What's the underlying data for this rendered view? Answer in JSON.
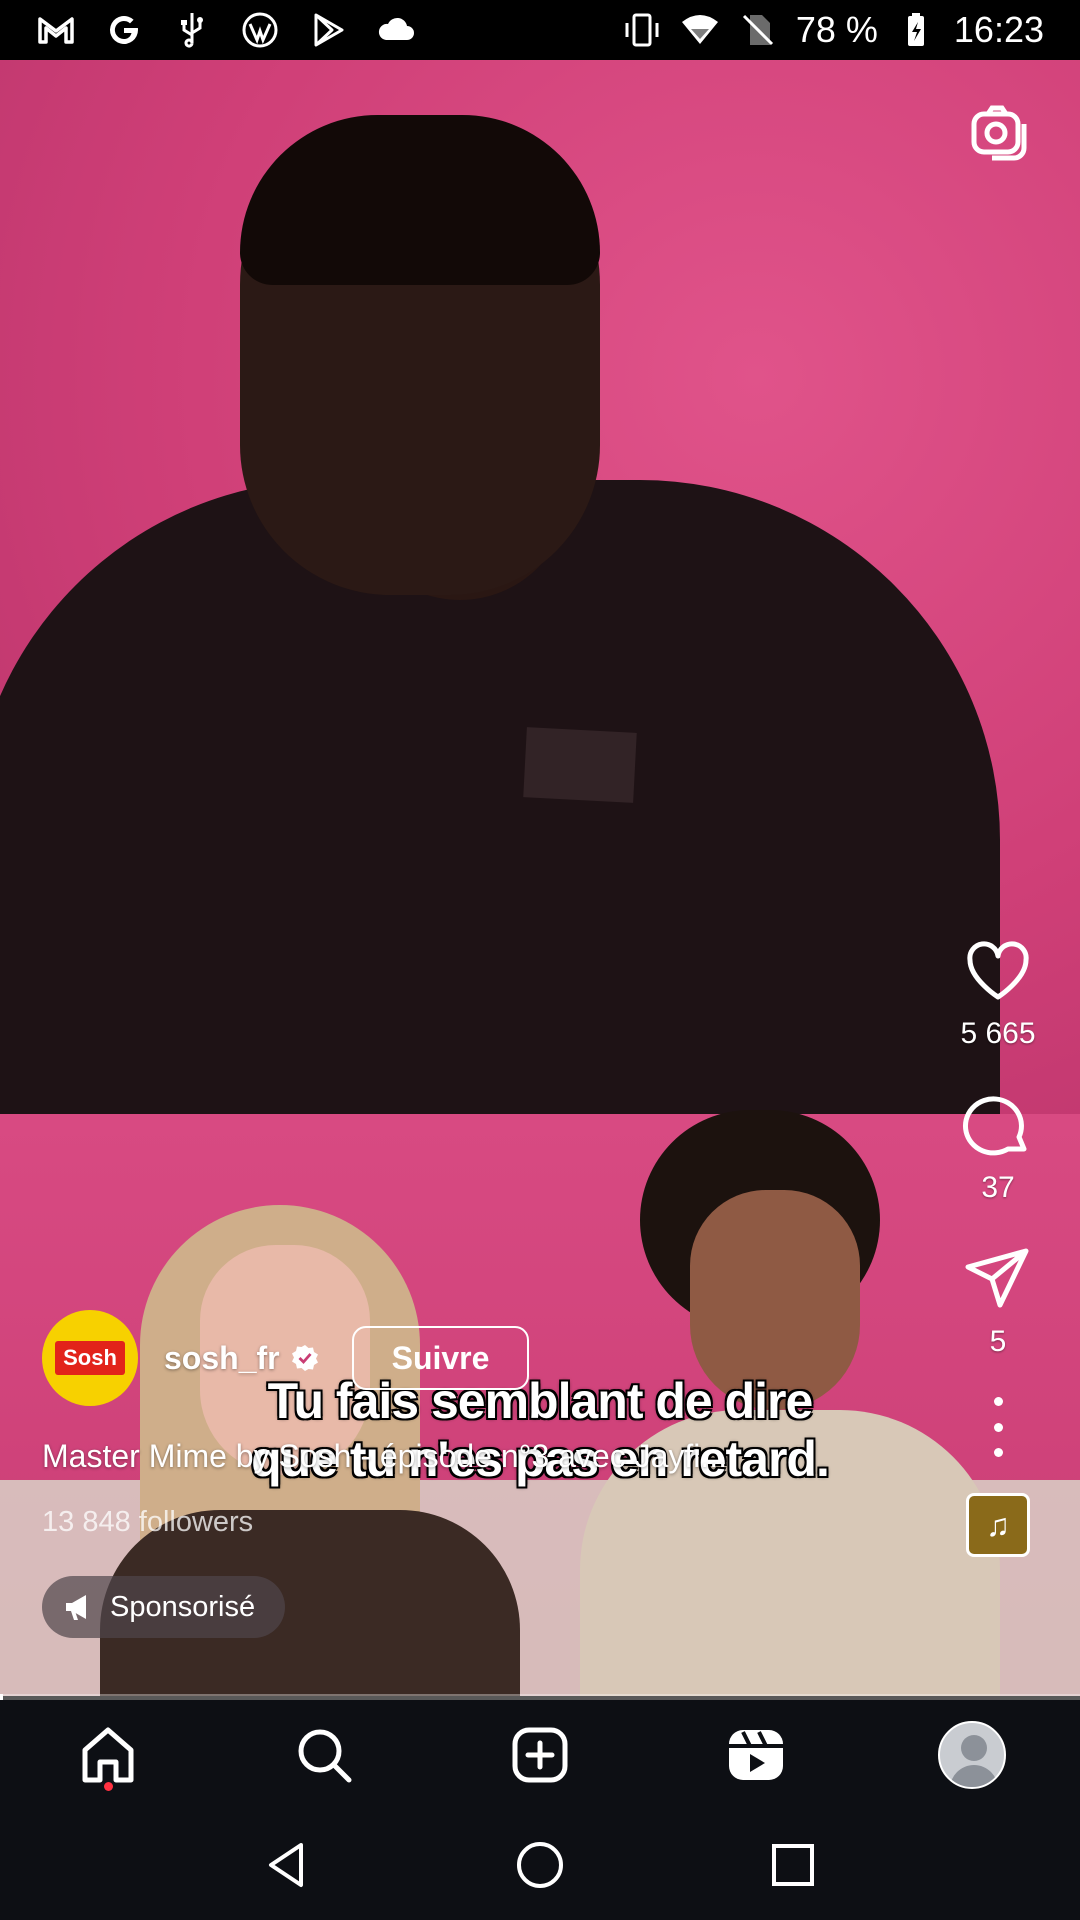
{
  "status_bar": {
    "left_icons": [
      "gmail-icon",
      "google-icon",
      "usb-icon",
      "wordpress-icon",
      "play-store-icon",
      "cloud-icon"
    ],
    "right_icons": [
      "vibrate-icon",
      "wifi-icon",
      "no-sim-icon"
    ],
    "battery": "78 %",
    "time": "16:23"
  },
  "video": {
    "subtitle_line1": "Tu fais semblant de dire",
    "subtitle_line2": "que tu n'es pas en retard.",
    "progress": 0.003
  },
  "actions": {
    "likes": "5 665",
    "comments": "37",
    "shares": "5"
  },
  "owner": {
    "avatar_text": "Sosh",
    "username": "sosh_fr",
    "follow_label": "Suivre"
  },
  "caption": "Master Mime by Sosh - épisode n°3 avec Jayfi...",
  "followers": "13 848 followers",
  "sponsored_label": "Sponsorisé",
  "colors": {
    "background_pink": "#d4467a",
    "avatar_yellow": "#f7d100",
    "brand_red": "#e2231a",
    "nav_bg": "#0d0f14",
    "notification_dot": "#ff3040"
  }
}
